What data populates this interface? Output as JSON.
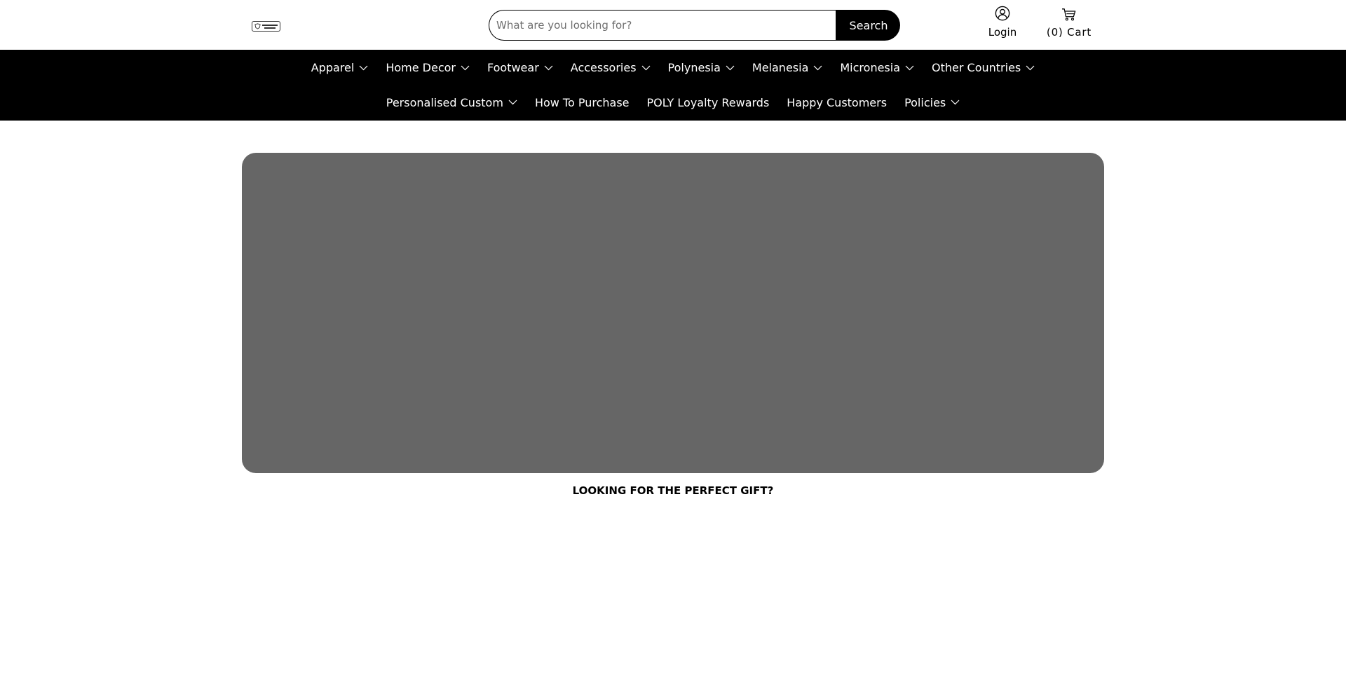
{
  "header": {
    "search": {
      "placeholder": "What are you looking for?",
      "value": "",
      "button_label": "Search"
    },
    "account": {
      "label": "Login",
      "icon": "user-circle-icon"
    },
    "cart": {
      "label": "(0) Cart",
      "count": 0,
      "icon": "cart-icon"
    },
    "logo": {
      "icon": "brand-logo-icon"
    }
  },
  "nav": {
    "row1": [
      {
        "label": "Apparel",
        "has_dropdown": true
      },
      {
        "label": "Home Decor",
        "has_dropdown": true
      },
      {
        "label": "Footwear",
        "has_dropdown": true
      },
      {
        "label": "Accessories",
        "has_dropdown": true
      },
      {
        "label": "Polynesia",
        "has_dropdown": true
      },
      {
        "label": "Melanesia",
        "has_dropdown": true
      },
      {
        "label": "Micronesia",
        "has_dropdown": true
      },
      {
        "label": "Other Countries",
        "has_dropdown": true
      }
    ],
    "row2": [
      {
        "label": "Personalised Custom",
        "has_dropdown": true
      },
      {
        "label": "How To Purchase",
        "has_dropdown": false
      },
      {
        "label": "POLY Loyalty Rewards",
        "has_dropdown": false
      },
      {
        "label": "Happy Customers",
        "has_dropdown": false
      },
      {
        "label": "Policies",
        "has_dropdown": true
      }
    ]
  },
  "main": {
    "promo_heading": "LOOKING FOR THE PERFECT GIFT?"
  },
  "colors": {
    "nav_background": "#000000",
    "hero_placeholder": "#666666",
    "accent": "#000000"
  }
}
